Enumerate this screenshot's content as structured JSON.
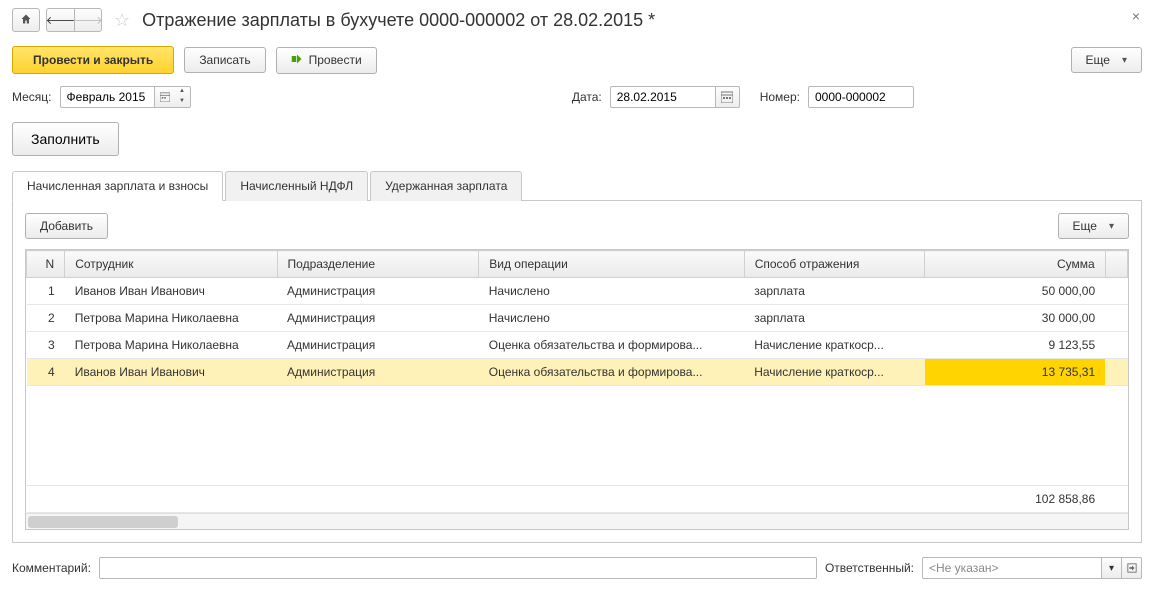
{
  "title": "Отражение зарплаты в бухучете 0000-000002 от 28.02.2015 *",
  "toolbar": {
    "primary": "Провести и закрыть",
    "save": "Записать",
    "post": "Провести",
    "more": "Еще"
  },
  "fields": {
    "month_label": "Месяц:",
    "month_value": "Февраль 2015",
    "date_label": "Дата:",
    "date_value": "28.02.2015",
    "number_label": "Номер:",
    "number_value": "0000-000002"
  },
  "fill_button": "Заполнить",
  "tabs": [
    "Начисленная зарплата и взносы",
    "Начисленный НДФЛ",
    "Удержанная зарплата"
  ],
  "panel": {
    "add": "Добавить",
    "more": "Еще"
  },
  "columns": {
    "n": "N",
    "emp": "Сотрудник",
    "dep": "Подразделение",
    "op": "Вид операции",
    "ref": "Способ отражения",
    "sum": "Сумма"
  },
  "rows": [
    {
      "n": "1",
      "emp": "Иванов Иван Иванович",
      "dep": "Администрация",
      "op": "Начислено",
      "ref": "зарплата",
      "sum": "50 000,00",
      "selected": false
    },
    {
      "n": "2",
      "emp": "Петрова Марина Николаевна",
      "dep": "Администрация",
      "op": "Начислено",
      "ref": "зарплата",
      "sum": "30 000,00",
      "selected": false
    },
    {
      "n": "3",
      "emp": "Петрова Марина Николаевна",
      "dep": "Администрация",
      "op": "Оценка обязательства и формирова...",
      "ref": "Начисление краткоср...",
      "sum": "9 123,55",
      "selected": false
    },
    {
      "n": "4",
      "emp": "Иванов Иван Иванович",
      "dep": "Администрация",
      "op": "Оценка обязательства и формирова...",
      "ref": "Начисление краткоср...",
      "sum": "13 735,31",
      "selected": true
    }
  ],
  "total": "102 858,86",
  "footer": {
    "comment_label": "Комментарий:",
    "responsible_label": "Ответственный:",
    "responsible_value": "<Не указан>"
  }
}
